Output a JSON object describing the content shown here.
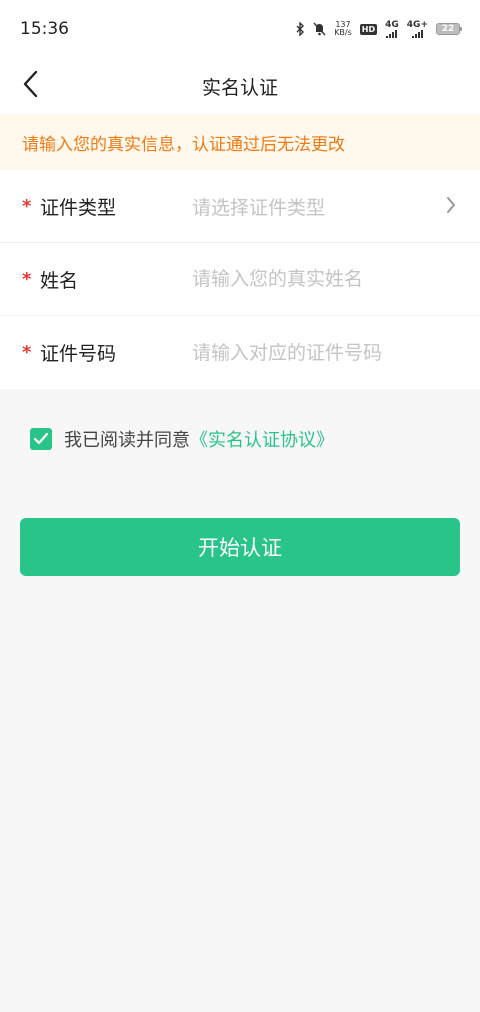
{
  "status_bar": {
    "time": "15:36",
    "speed_value": "137",
    "speed_unit": "KB/s",
    "hd_label": "HD",
    "net1": "4G",
    "net2": "4G+",
    "battery": "22"
  },
  "header": {
    "title": "实名认证"
  },
  "notice": {
    "text": "请输入您的真实信息，认证通过后无法更改"
  },
  "form": {
    "required_mark": "*",
    "id_type": {
      "label": "证件类型",
      "placeholder": "请选择证件类型"
    },
    "name": {
      "label": "姓名",
      "placeholder": "请输入您的真实姓名"
    },
    "id_number": {
      "label": "证件号码",
      "placeholder": "请输入对应的证件号码"
    }
  },
  "agreement": {
    "text": "我已阅读并同意",
    "link": "《实名认证协议》",
    "checked": true
  },
  "submit": {
    "label": "开始认证"
  },
  "colors": {
    "accent": "#29c48a",
    "notice_text": "#f07a14",
    "notice_bg": "#fff8ec",
    "required": "#e53935"
  }
}
